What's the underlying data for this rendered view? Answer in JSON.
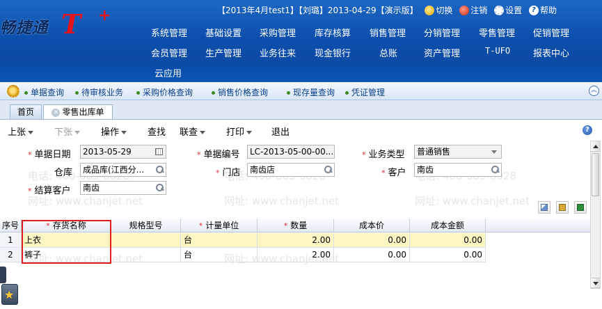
{
  "brand": {
    "logo_text": "畅捷通",
    "logo_tplus": "T",
    "logo_plus": "+"
  },
  "topbar": {
    "session": "【2013年4月test1】【刘璐】2013-04-29【演示版】",
    "switch": "切换",
    "logout": "注销",
    "settings": "设置",
    "help": "帮助"
  },
  "menu": {
    "row1": [
      "系统管理",
      "基础设置",
      "采购管理",
      "库存核算",
      "销售管理",
      "分销管理",
      "零售管理",
      "促销管理"
    ],
    "row2": [
      "会员管理",
      "生产管理",
      "业务往来",
      "现金银行",
      "总账",
      "资产管理",
      "T-UFO",
      "报表中心"
    ],
    "row3": [
      "云应用"
    ]
  },
  "quicklinks": [
    "单据查询",
    "待审核业务",
    "采购价格查询",
    "销售价格查询",
    "现存量查询",
    "凭证管理"
  ],
  "tabs": {
    "home": "首页",
    "active": "零售出库单"
  },
  "toolbar": {
    "prev": "上张",
    "next": "下张",
    "operate": "操作",
    "find": "查找",
    "link": "联查",
    "print": "打印",
    "exit": "退出"
  },
  "form": {
    "date_label": "单据日期",
    "date_value": "2013-05-29",
    "code_label": "单据编号",
    "code_value": "LC-2013-05-00-00...",
    "biztype_label": "业务类型",
    "biztype_value": "普通销售",
    "warehouse_label": "仓库",
    "warehouse_value": "成品库(江西分...",
    "store_label": "门店",
    "store_value": "南齿店",
    "customer_label": "客户",
    "customer_value": "南齿",
    "settle_label": "结算客户",
    "settle_value": "南齿"
  },
  "watermark": {
    "phone": "电话: 400-665-0028",
    "site": "网址: www.chanjet.net"
  },
  "grid": {
    "headers": [
      "序号",
      "存货名称",
      "规格型号",
      "计量单位",
      "数量",
      "成本价",
      "成本金额"
    ],
    "required": [
      false,
      true,
      false,
      true,
      true,
      false,
      false
    ],
    "rows": [
      {
        "no": "1",
        "name": "上衣",
        "spec": "",
        "unit": "台",
        "qty": "2.00",
        "price": "0.00",
        "amount": "0.00"
      },
      {
        "no": "2",
        "name": "裤子",
        "spec": "",
        "unit": "台",
        "qty": "2.00",
        "price": "0.00",
        "amount": "0.00"
      }
    ]
  },
  "colors": {
    "header_blue": "#0d4fad",
    "required_red": "#e0282c",
    "highlight_box": "#e11b1b",
    "selected_row": "#fdf6c2"
  }
}
